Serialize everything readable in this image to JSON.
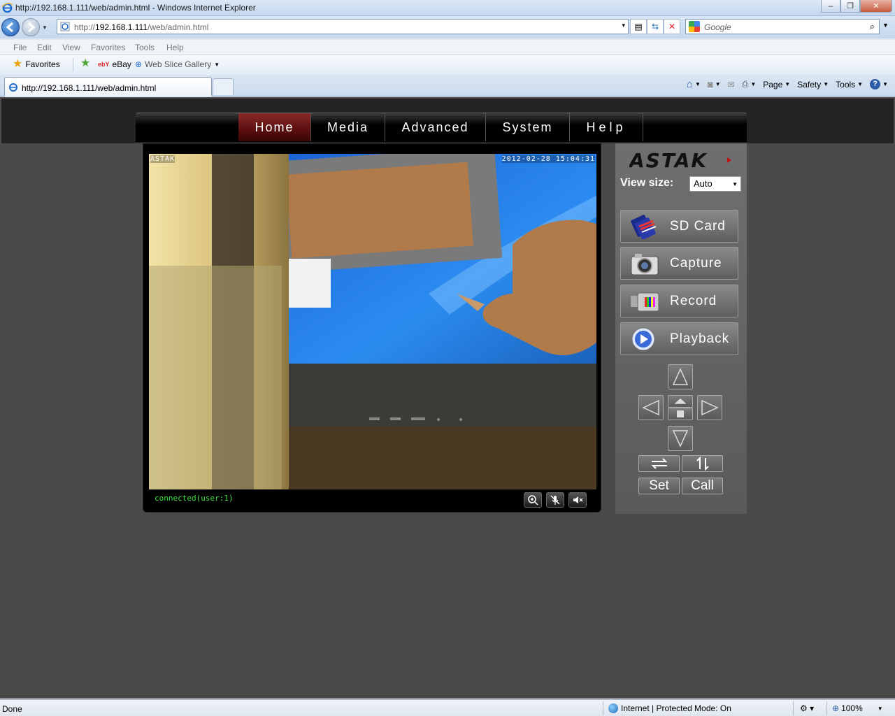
{
  "window": {
    "title": "http://192.168.1.111/web/admin.html - Windows Internet Explorer",
    "min_label": "–",
    "max_label": "❐",
    "close_label": "✕"
  },
  "address": {
    "url_prefix": "http://",
    "url_host": "192.168.1.111",
    "url_path": "/web/admin.html",
    "dropdown": "▾"
  },
  "search": {
    "placeholder": "Google",
    "icon": "⌕"
  },
  "menu": [
    "File",
    "Edit",
    "View",
    "Favorites",
    "Tools",
    "Help"
  ],
  "favorites": {
    "favorites_label": "Favorites",
    "ebay_label": "eBay",
    "webslice_label": "Web Slice Gallery"
  },
  "tab": {
    "label": "http://192.168.1.111/web/admin.html"
  },
  "commands": {
    "page": "Page",
    "safety": "Safety",
    "tools": "Tools"
  },
  "site_nav": {
    "tabs": [
      "Home",
      "Media",
      "Advanced",
      "System",
      "Help"
    ],
    "active": "Home",
    "accent_color": "#7a1c1c"
  },
  "video": {
    "osd_left": "ASTAK",
    "osd_right": "2012-02-28 15:04:31",
    "status": "connected(user:1)",
    "controls": [
      "zoom-icon",
      "mic-mute-icon",
      "speaker-mute-icon"
    ]
  },
  "side": {
    "brand": "ASTAK",
    "view_size_label": "View size:",
    "view_size_value": "Auto",
    "buttons": {
      "sdcard": "SD Card",
      "capture": "Capture",
      "record": "Record",
      "playback": "Playback"
    },
    "preset": {
      "set": "Set",
      "call": "Call"
    }
  },
  "statusbar": {
    "left": "Done",
    "zone": "Internet | Protected Mode: On",
    "zoom": "100%"
  }
}
